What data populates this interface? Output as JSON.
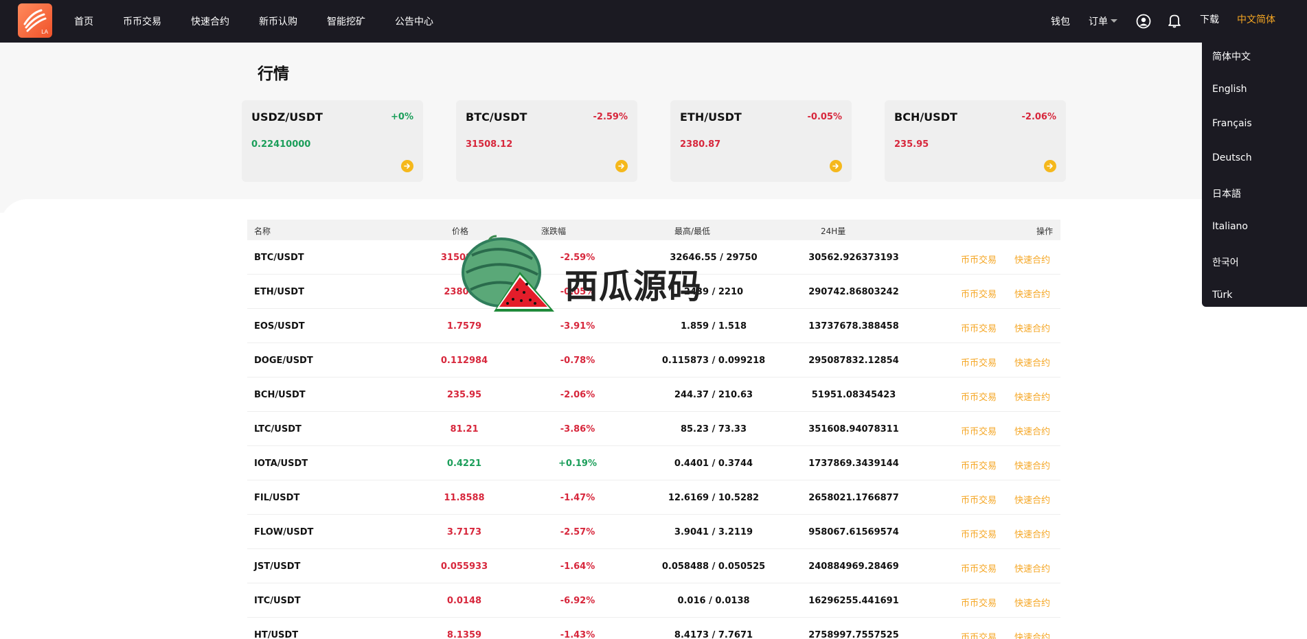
{
  "nav": {
    "logo_text": "LA",
    "items": [
      "首页",
      "币币交易",
      "快速合约",
      "新币认购",
      "智能挖矿",
      "公告中心"
    ],
    "wallet": "钱包",
    "orders": "订单",
    "download": "下载",
    "language": "中文简体"
  },
  "lang_menu": [
    "简体中文",
    "English",
    "Français",
    "Deutsch",
    "日本語",
    "Italiano",
    "한국어",
    "Türk"
  ],
  "page": {
    "title": "行情"
  },
  "cards": [
    {
      "pair": "USDZ/USDT",
      "change": "+0%",
      "price": "0.22410000",
      "trend": "up"
    },
    {
      "pair": "BTC/USDT",
      "change": "-2.59%",
      "price": "31508.12",
      "trend": "down"
    },
    {
      "pair": "ETH/USDT",
      "change": "-0.05%",
      "price": "2380.87",
      "trend": "down"
    },
    {
      "pair": "BCH/USDT",
      "change": "-2.06%",
      "price": "235.95",
      "trend": "down"
    }
  ],
  "table": {
    "headers": {
      "name": "名称",
      "price": "价格",
      "change": "涨跌幅",
      "highlow": "最高/最低",
      "volume": "24H量",
      "action": "操作"
    },
    "rows": [
      {
        "name": "BTC/USDT",
        "price": "31508.12",
        "change": "-2.59%",
        "highlow": "32646.55 / 29750",
        "volume": "30562.926373193",
        "trend": "down"
      },
      {
        "name": "ETH/USDT",
        "price": "2380.87",
        "change": "-0.05%",
        "highlow": "2439 / 2210",
        "volume": "290742.86803242",
        "trend": "down"
      },
      {
        "name": "EOS/USDT",
        "price": "1.7579",
        "change": "-3.91%",
        "highlow": "1.859 / 1.518",
        "volume": "13737678.388458",
        "trend": "down"
      },
      {
        "name": "DOGE/USDT",
        "price": "0.112984",
        "change": "-0.78%",
        "highlow": "0.115873 / 0.099218",
        "volume": "295087832.12854",
        "trend": "down"
      },
      {
        "name": "BCH/USDT",
        "price": "235.95",
        "change": "-2.06%",
        "highlow": "244.37 / 210.63",
        "volume": "51951.08345423",
        "trend": "down"
      },
      {
        "name": "LTC/USDT",
        "price": "81.21",
        "change": "-3.86%",
        "highlow": "85.23 / 73.33",
        "volume": "351608.94078311",
        "trend": "down"
      },
      {
        "name": "IOTA/USDT",
        "price": "0.4221",
        "change": "+0.19%",
        "highlow": "0.4401 / 0.3744",
        "volume": "1737869.3439144",
        "trend": "up"
      },
      {
        "name": "FIL/USDT",
        "price": "11.8588",
        "change": "-1.47%",
        "highlow": "12.6169 / 10.5282",
        "volume": "2658021.1766877",
        "trend": "down"
      },
      {
        "name": "FLOW/USDT",
        "price": "3.7173",
        "change": "-2.57%",
        "highlow": "3.9041 / 3.2119",
        "volume": "958067.61569574",
        "trend": "down"
      },
      {
        "name": "JST/USDT",
        "price": "0.055933",
        "change": "-1.64%",
        "highlow": "0.058488 / 0.050525",
        "volume": "240884969.28469",
        "trend": "down"
      },
      {
        "name": "ITC/USDT",
        "price": "0.0148",
        "change": "-6.92%",
        "highlow": "0.016 / 0.0138",
        "volume": "16296255.441691",
        "trend": "down"
      },
      {
        "name": "HT/USDT",
        "price": "8.1359",
        "change": "-1.43%",
        "highlow": "8.4173 / 7.7671",
        "volume": "2758997.7557525",
        "trend": "down"
      }
    ],
    "action_trade": "币币交易",
    "action_contract": "快速合约"
  },
  "watermark": {
    "text": "西瓜源码"
  },
  "colors": {
    "up": "#1b9e5a",
    "down": "#d7273c",
    "accent": "#f5a623",
    "nav_bg": "#1b1a22"
  },
  "icons": {
    "card_arrow": "arrow-right-circle-icon",
    "user": "user-circle-icon",
    "bell": "bell-icon",
    "dropdown": "caret-down-icon"
  }
}
